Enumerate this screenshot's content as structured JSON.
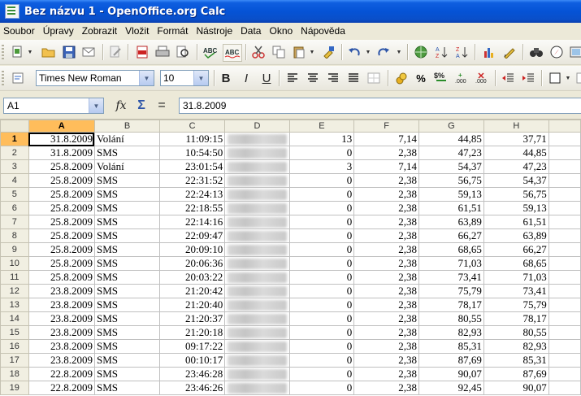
{
  "window": {
    "title": "Bez názvu 1 - OpenOffice.org Calc"
  },
  "menu": [
    "Soubor",
    "Úpravy",
    "Zobrazit",
    "Vložit",
    "Formát",
    "Nástroje",
    "Data",
    "Okno",
    "Nápověda"
  ],
  "format_toolbar": {
    "font_name": "Times New Roman",
    "font_size": "10",
    "bold": "B",
    "italic": "I",
    "underline": "U"
  },
  "formula_bar": {
    "cell_ref": "A1",
    "function_wizard": "fx",
    "sum": "Σ",
    "equals": "=",
    "content": "31.8.2009"
  },
  "sheet": {
    "columns": [
      "A",
      "B",
      "C",
      "D",
      "E",
      "F",
      "G",
      "H"
    ],
    "rows": [
      {
        "n": "1",
        "a": "31.8.2009",
        "b": "Volání",
        "c": "11:09:15",
        "e": "13",
        "f": "7,14",
        "g": "44,85",
        "h": "37,71"
      },
      {
        "n": "2",
        "a": "31.8.2009",
        "b": "SMS",
        "c": "10:54:50",
        "e": "0",
        "f": "2,38",
        "g": "47,23",
        "h": "44,85"
      },
      {
        "n": "3",
        "a": "25.8.2009",
        "b": "Volání",
        "c": "23:01:54",
        "e": "3",
        "f": "7,14",
        "g": "54,37",
        "h": "47,23"
      },
      {
        "n": "4",
        "a": "25.8.2009",
        "b": "SMS",
        "c": "22:31:52",
        "e": "0",
        "f": "2,38",
        "g": "56,75",
        "h": "54,37"
      },
      {
        "n": "5",
        "a": "25.8.2009",
        "b": "SMS",
        "c": "22:24:13",
        "e": "0",
        "f": "2,38",
        "g": "59,13",
        "h": "56,75"
      },
      {
        "n": "6",
        "a": "25.8.2009",
        "b": "SMS",
        "c": "22:18:55",
        "e": "0",
        "f": "2,38",
        "g": "61,51",
        "h": "59,13"
      },
      {
        "n": "7",
        "a": "25.8.2009",
        "b": "SMS",
        "c": "22:14:16",
        "e": "0",
        "f": "2,38",
        "g": "63,89",
        "h": "61,51"
      },
      {
        "n": "8",
        "a": "25.8.2009",
        "b": "SMS",
        "c": "22:09:47",
        "e": "0",
        "f": "2,38",
        "g": "66,27",
        "h": "63,89"
      },
      {
        "n": "9",
        "a": "25.8.2009",
        "b": "SMS",
        "c": "20:09:10",
        "e": "0",
        "f": "2,38",
        "g": "68,65",
        "h": "66,27"
      },
      {
        "n": "10",
        "a": "25.8.2009",
        "b": "SMS",
        "c": "20:06:36",
        "e": "0",
        "f": "2,38",
        "g": "71,03",
        "h": "68,65"
      },
      {
        "n": "11",
        "a": "25.8.2009",
        "b": "SMS",
        "c": "20:03:22",
        "e": "0",
        "f": "2,38",
        "g": "73,41",
        "h": "71,03"
      },
      {
        "n": "12",
        "a": "23.8.2009",
        "b": "SMS",
        "c": "21:20:42",
        "e": "0",
        "f": "2,38",
        "g": "75,79",
        "h": "73,41"
      },
      {
        "n": "13",
        "a": "23.8.2009",
        "b": "SMS",
        "c": "21:20:40",
        "e": "0",
        "f": "2,38",
        "g": "78,17",
        "h": "75,79"
      },
      {
        "n": "14",
        "a": "23.8.2009",
        "b": "SMS",
        "c": "21:20:37",
        "e": "0",
        "f": "2,38",
        "g": "80,55",
        "h": "78,17"
      },
      {
        "n": "15",
        "a": "23.8.2009",
        "b": "SMS",
        "c": "21:20:18",
        "e": "0",
        "f": "2,38",
        "g": "82,93",
        "h": "80,55"
      },
      {
        "n": "16",
        "a": "23.8.2009",
        "b": "SMS",
        "c": "09:17:22",
        "e": "0",
        "f": "2,38",
        "g": "85,31",
        "h": "82,93"
      },
      {
        "n": "17",
        "a": "23.8.2009",
        "b": "SMS",
        "c": "00:10:17",
        "e": "0",
        "f": "2,38",
        "g": "87,69",
        "h": "85,31"
      },
      {
        "n": "18",
        "a": "22.8.2009",
        "b": "SMS",
        "c": "23:46:28",
        "e": "0",
        "f": "2,38",
        "g": "90,07",
        "h": "87,69"
      },
      {
        "n": "19",
        "a": "22.8.2009",
        "b": "SMS",
        "c": "23:46:26",
        "e": "0",
        "f": "2,38",
        "g": "92,45",
        "h": "90,07"
      }
    ]
  },
  "colors": {
    "title_bar": "#0553d6",
    "selected_header": "#ffbd5b"
  }
}
